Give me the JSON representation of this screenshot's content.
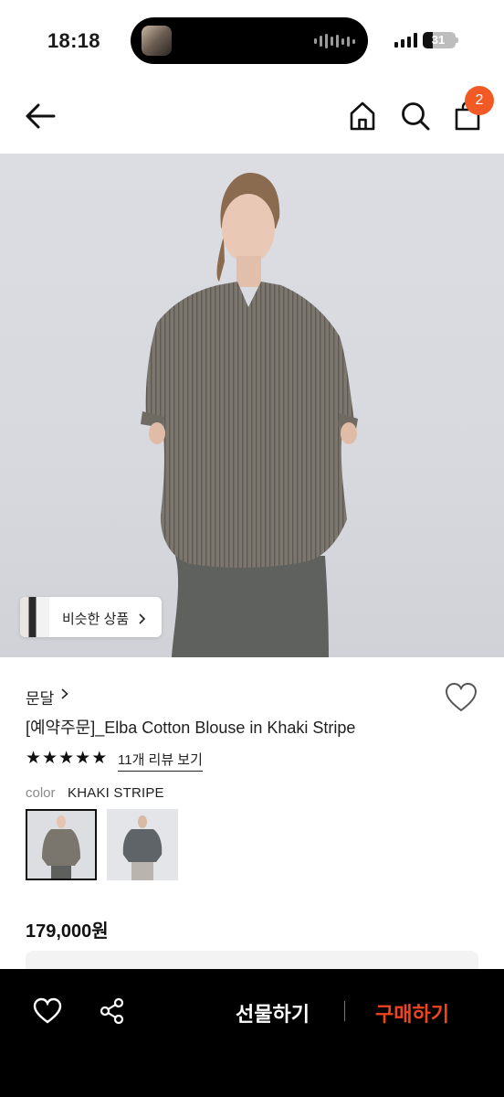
{
  "status_bar": {
    "time": "18:18",
    "battery_level": "31"
  },
  "header": {
    "cart_count": "2",
    "icons": [
      "back-arrow-icon",
      "home-icon",
      "search-icon",
      "shopping-bag-icon"
    ]
  },
  "hero": {
    "similar_products_label": "비슷한 상품"
  },
  "product": {
    "brand": "문달",
    "title": "[예약주문]_Elba Cotton Blouse in Khaki Stripe",
    "rating_stars": 5,
    "review_link": "11개 리뷰 보기",
    "color_label": "color",
    "color_value": "KHAKI STRIPE",
    "price": "179,000원"
  },
  "bottom_bar": {
    "gift_label": "선물하기",
    "buy_label": "구매하기",
    "colors": {
      "background": "#000000",
      "buy": "#f0441f",
      "gift": "#ffffff"
    }
  },
  "colors": {
    "accent_badge": "#f15a24"
  }
}
